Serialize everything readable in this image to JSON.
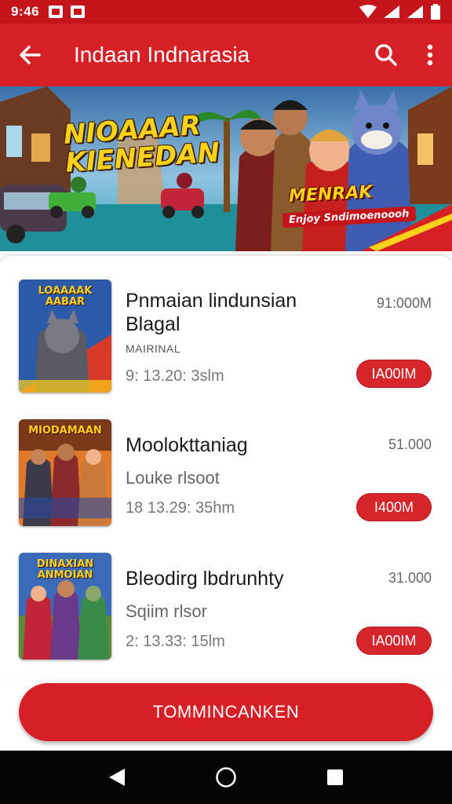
{
  "status_bar": {
    "time": "9:46"
  },
  "app_bar": {
    "title": "Indaan Indnarasia"
  },
  "banner": {
    "title": "NIOAAAR KIENEDAN",
    "subtitle": "MENRAK",
    "tagline": "Enjoy Sndimoenoooh"
  },
  "items": [
    {
      "thumb_title": "LOAAAAK AABAR",
      "name_line1": "Pnmaian lindunsian",
      "name_line2": "Blagal",
      "tag": "MAIRINAL",
      "meta": "9: 13.20: 3slm",
      "price": "91:000M",
      "button": "IA00IM"
    },
    {
      "thumb_title": "MIODAMAAN",
      "name_line1": "Moolokttaniag",
      "sub": "Louke rlsoot",
      "meta": "18 13.29: 35hm",
      "price": "51.000",
      "button": "I400M"
    },
    {
      "thumb_title": "DINAXIAN ANMOIAN",
      "name_line1": "Bleodirg lbdrunhty",
      "sub": "Sqiim rlsor",
      "meta": "2: 13.33: 15lm",
      "price": "31.000",
      "button": "IA00IM"
    }
  ],
  "cta": {
    "label": "TOMMINCANKEN"
  },
  "colors": {
    "primary": "#d71f26",
    "status": "#c4151b",
    "nav": "#050505"
  }
}
